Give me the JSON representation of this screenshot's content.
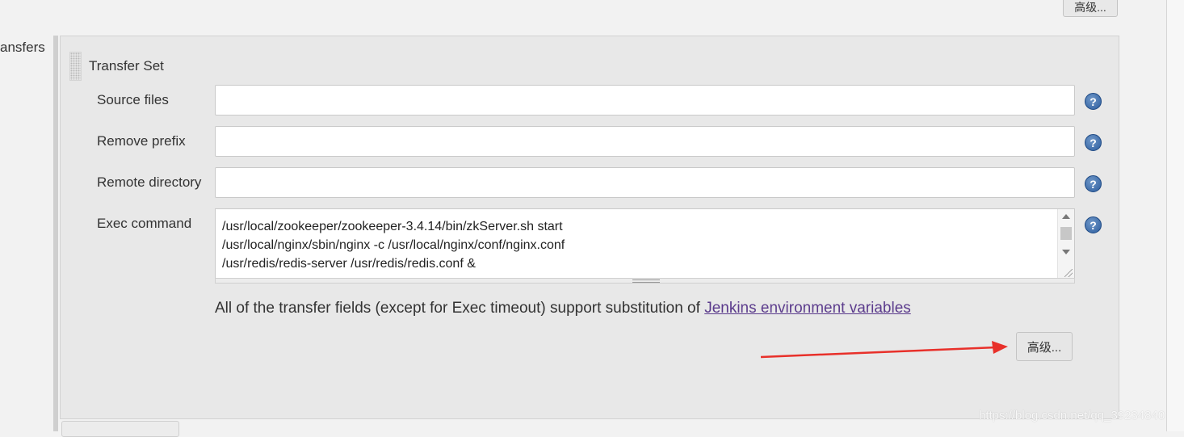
{
  "section": {
    "label": "ansfers"
  },
  "top_advanced_button": {
    "label": "高级..."
  },
  "transfer_set": {
    "title": "Transfer Set",
    "fields": {
      "source_files": {
        "label": "Source files",
        "value": ""
      },
      "remove_prefix": {
        "label": "Remove prefix",
        "value": ""
      },
      "remote_directory": {
        "label": "Remote directory",
        "value": ""
      },
      "exec_command": {
        "label": "Exec command",
        "value": "/usr/local/zookeeper/zookeeper-3.4.14/bin/zkServer.sh start\n/usr/local/nginx/sbin/nginx -c /usr/local/nginx/conf/nginx.conf\n/usr/redis/redis-server /usr/redis/redis.conf &"
      }
    },
    "help_icon": "help-question-icon",
    "info_text": "All of the transfer fields (except for Exec timeout) support substitution of ",
    "info_link": "Jenkins environment variables",
    "advanced_button": {
      "label": "高级..."
    }
  },
  "annotation": {
    "arrow_color": "#e8302a"
  },
  "watermark": "https://blog.csdn.net/qq_39234840",
  "colors": {
    "panel_bg": "#e8e8e8",
    "link": "#5b3b8c",
    "help_icon": "#2c5d9e"
  }
}
